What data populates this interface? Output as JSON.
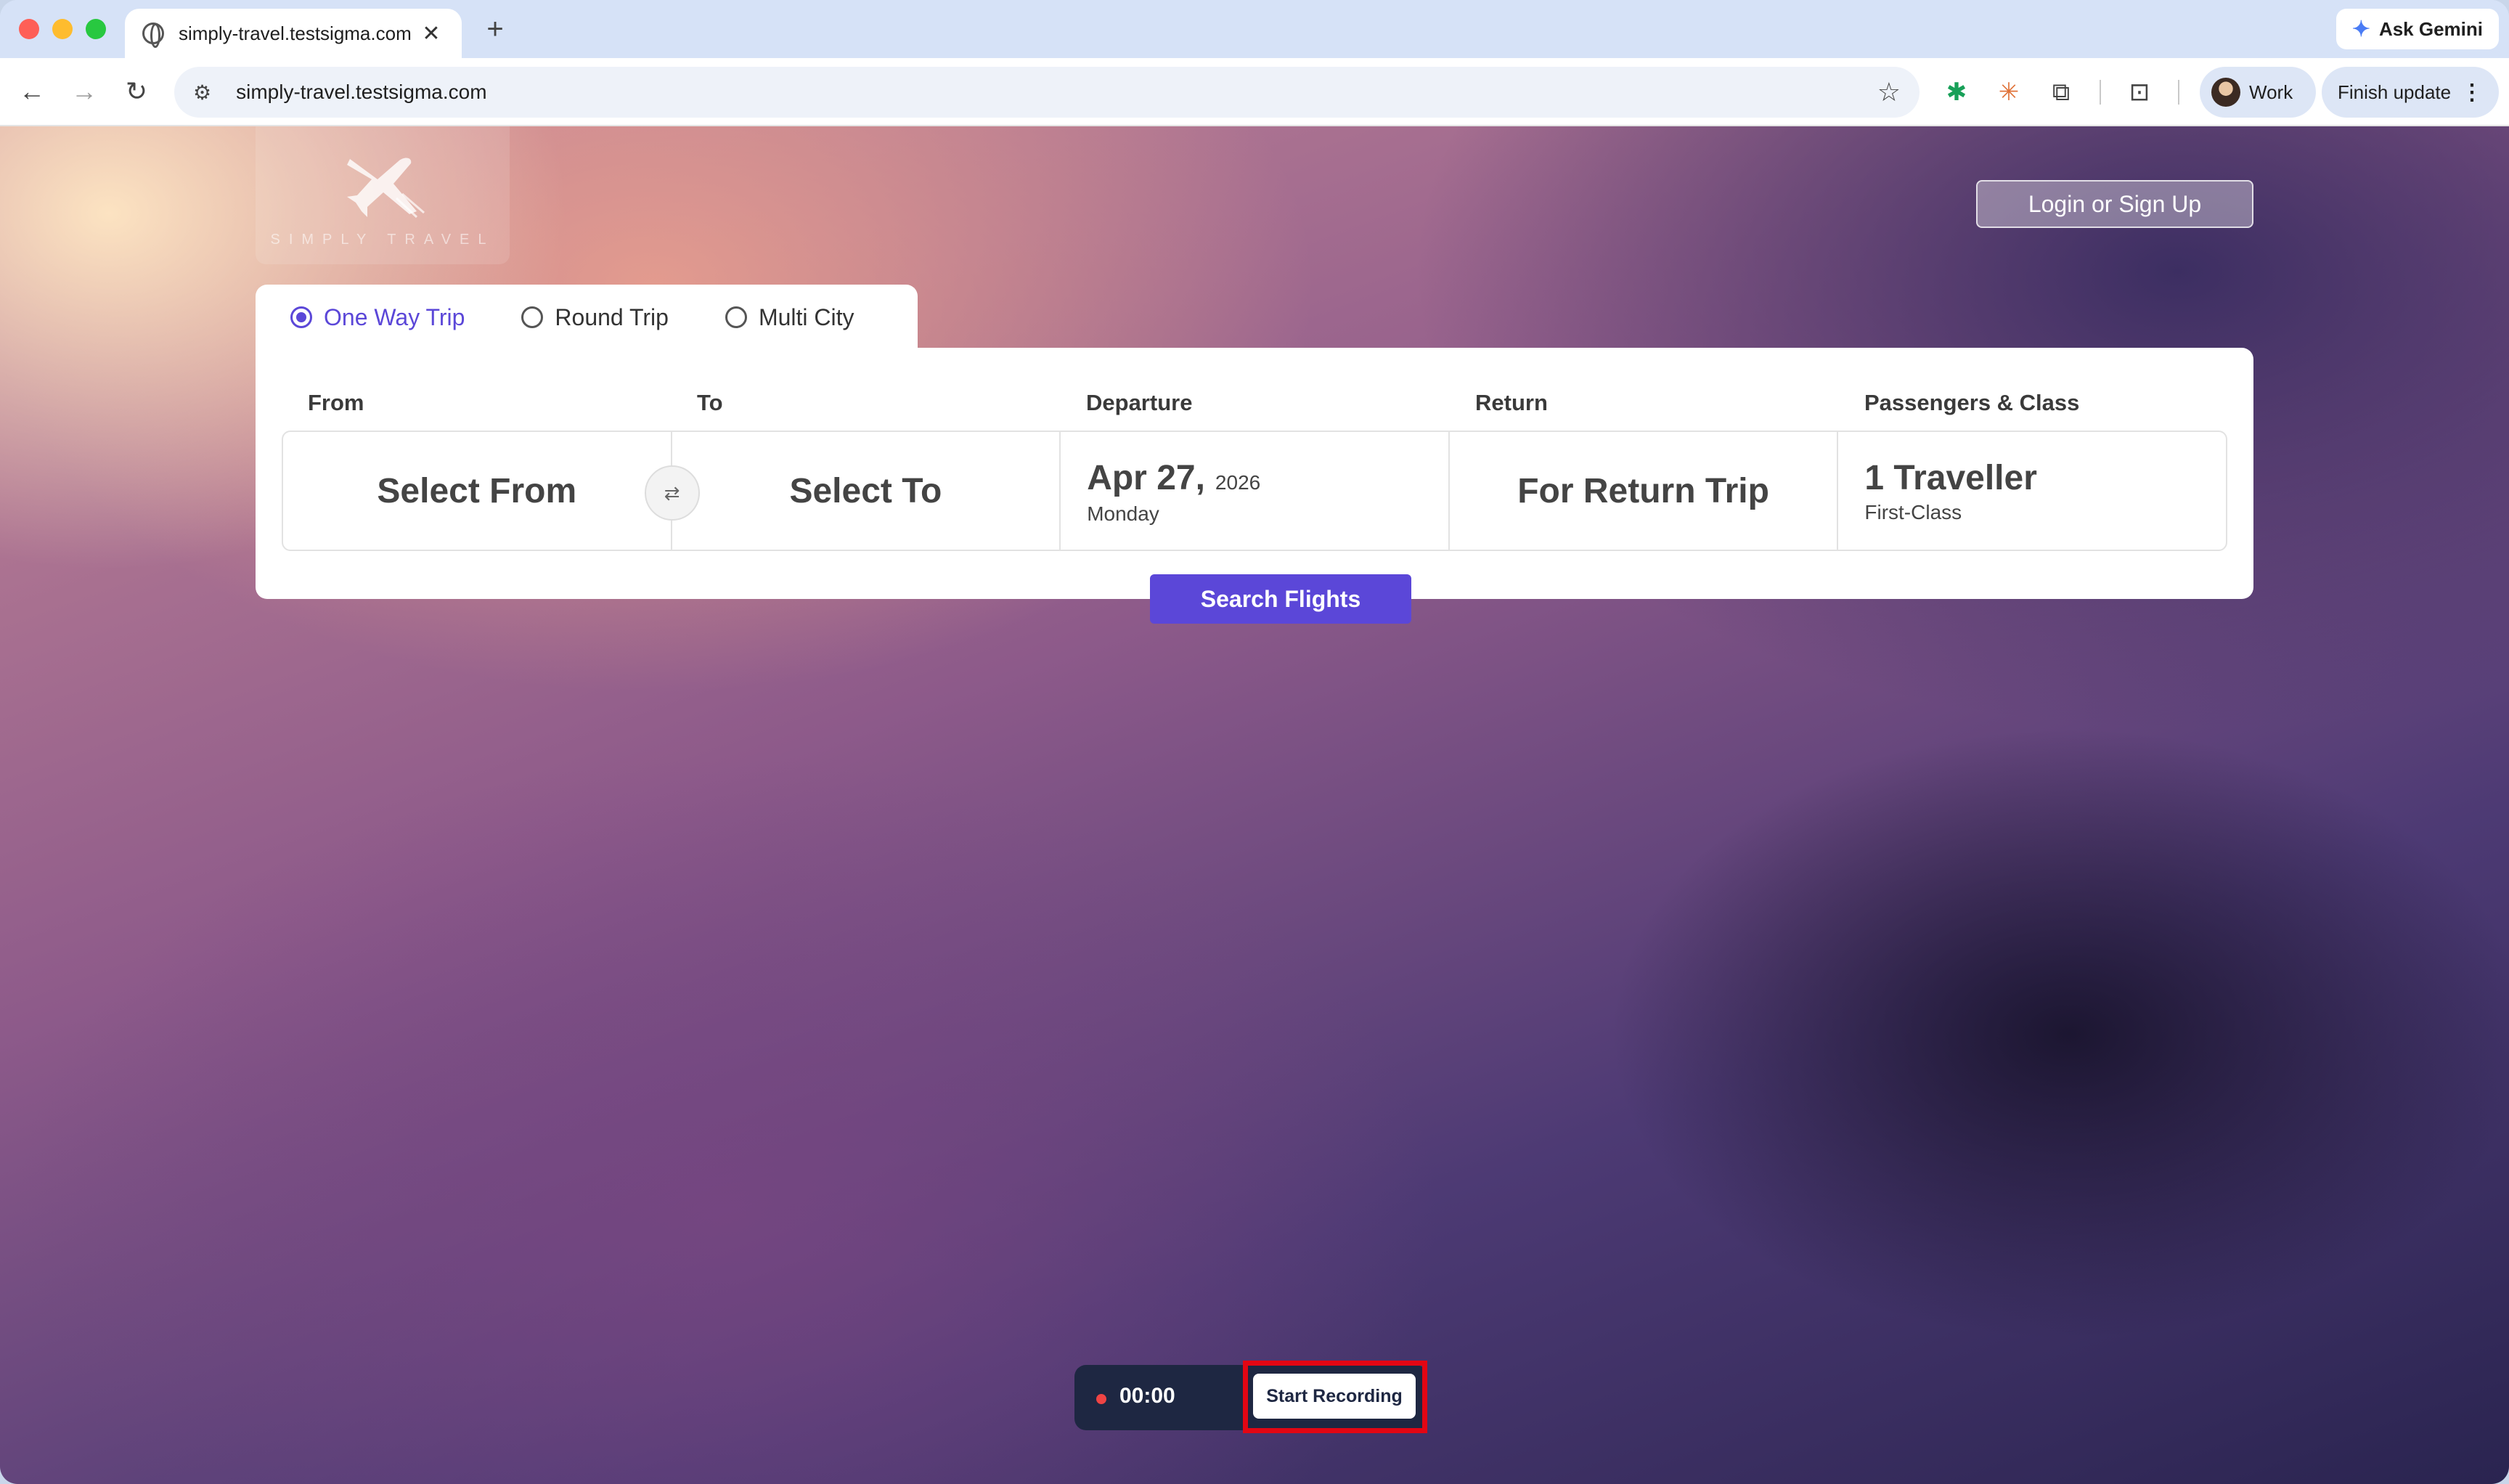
{
  "browser": {
    "tab_title": "simply-travel.testsigma.com",
    "tab_close": "✕",
    "new_tab": "+",
    "ask_gemini": "Ask Gemini",
    "url": "simply-travel.testsigma.com",
    "profile_label": "Work",
    "finish_update": "Finish update"
  },
  "site": {
    "logo_text": "SIMPLY TRAVEL",
    "login_label": "Login or Sign Up"
  },
  "trip_types": [
    {
      "label": "One Way Trip",
      "selected": true
    },
    {
      "label": "Round Trip",
      "selected": false
    },
    {
      "label": "Multi City",
      "selected": false
    }
  ],
  "search": {
    "labels": {
      "from": "From",
      "to": "To",
      "departure": "Departure",
      "return": "Return",
      "passengers": "Passengers & Class"
    },
    "from_value": "Select From",
    "swap_symbol": "⇄",
    "to_value": "Select To",
    "departure_date": "Apr 27,",
    "departure_year": "2026",
    "departure_day": "Monday",
    "return_value": "For Return Trip",
    "passengers_value": "1 Traveller",
    "class_value": "First-Class",
    "search_button": "Search Flights"
  },
  "recorder": {
    "time": "00:00",
    "start_label": "Start Recording"
  },
  "colors": {
    "accent": "#5b47d8",
    "recorder_bg": "#1e2742",
    "highlight": "#e30613"
  }
}
